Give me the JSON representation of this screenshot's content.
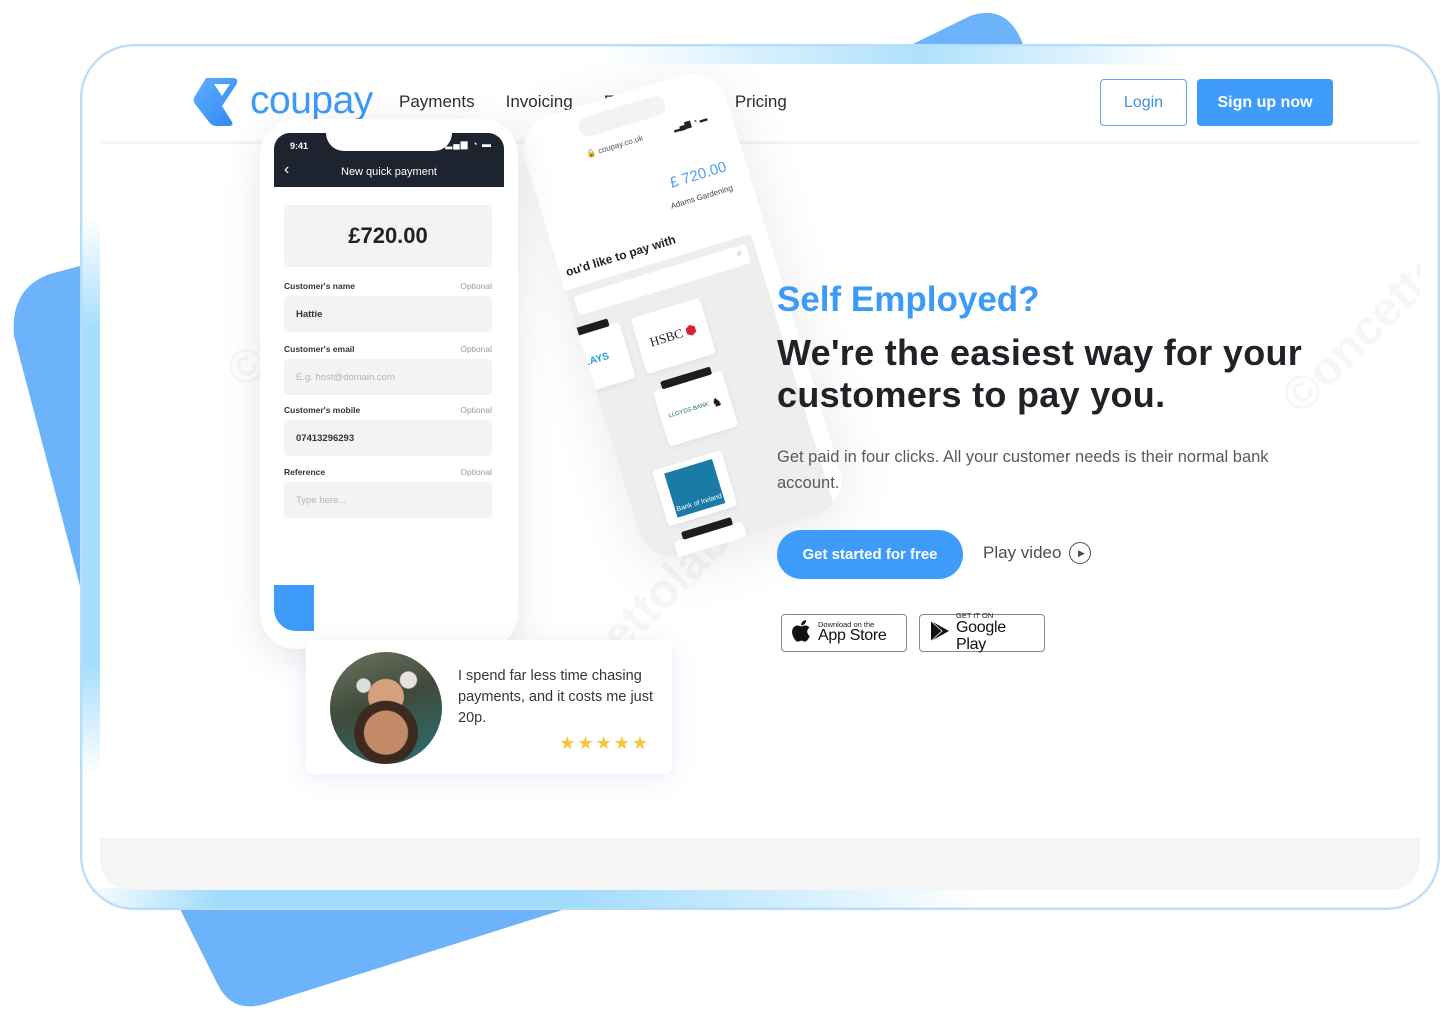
{
  "brand": {
    "name": "coupay",
    "accent": "#3e9bfa",
    "logo_icon": "coupay-logo-icon"
  },
  "nav": {
    "links": [
      "Payments",
      "Invoicing",
      "E-Commerce",
      "Pricing"
    ],
    "login_label": "Login",
    "signup_label": "Sign up now"
  },
  "hero": {
    "eyebrow": "Self Employed?",
    "headline": "We're the easiest way for your customers to pay you.",
    "subtext": "Get paid in four clicks. All your customer needs is their normal bank account.",
    "cta_label": "Get started for free",
    "play_label": "Play video",
    "play_icon": "play-circle-icon",
    "app_store": {
      "small": "Download on the",
      "big": "App Store",
      "icon": "apple-icon"
    },
    "google_play": {
      "small": "GET IT ON",
      "big": "Google Play",
      "icon": "google-play-icon"
    }
  },
  "phone_front": {
    "time": "9:41",
    "status_icons": "signal wifi battery",
    "title": "New quick payment",
    "amount": "£720.00",
    "fields": [
      {
        "label": "Customer's name",
        "optional": "Optional",
        "value": "Hattie",
        "placeholder": ""
      },
      {
        "label": "Customer's email",
        "optional": "Optional",
        "value": "",
        "placeholder": "E.g. host@domain.com"
      },
      {
        "label": "Customer's mobile",
        "optional": "Optional",
        "value": "07413296293",
        "placeholder": ""
      },
      {
        "label": "Reference",
        "optional": "Optional",
        "value": "",
        "placeholder": "Type here..."
      }
    ]
  },
  "phone_back": {
    "url": "coupay.co.uk",
    "amount": "£ 720.00",
    "merchant": "Adams Gardening",
    "prompt": "ou'd like to pay with",
    "banks": [
      "CLAYS",
      "HSBC",
      "LLOYDS BANK",
      "Bank of Ireland"
    ]
  },
  "review": {
    "quote": "I spend far less time chasing payments, and it costs me just 20p.",
    "rating": 5,
    "max_rating": 5
  }
}
